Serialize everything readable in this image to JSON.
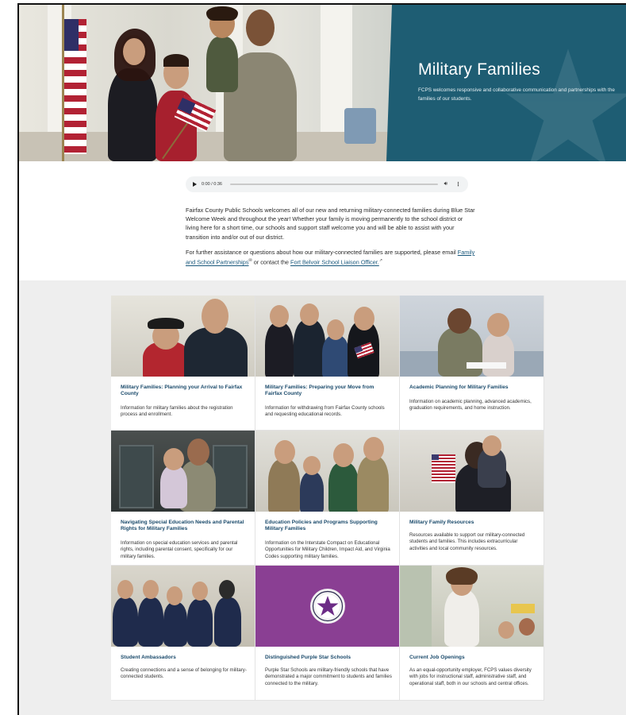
{
  "hero": {
    "title": "Military Families",
    "subtitle": "FCPS welcomes responsive and collaborative communication and partnerships with the families of our students."
  },
  "audio": {
    "time": "0:00 / 0:36",
    "progress": 0.0
  },
  "intro": {
    "paragraph1": "Fairfax County Public Schools welcomes all of our new and returning military-connected families during Blue Star Welcome Week and throughout the year!  Whether your family is moving permanently to the school district or living here for a short time, our schools and support staff welcome you and will be able to assist with your transition into and/or out of our district.",
    "paragraph2_prefix": "For further assistance or questions about how our military-connected families are supported, please email",
    "link1": "Family and School Partnerships",
    "paragraph2_mid": "or contact the",
    "link2": "Fort Belvoir School Liaison Officer."
  },
  "cards": [
    {
      "title": "Military Families: Planning your Arrival to Fairfax County",
      "description": "Information for military families about the registration process and enrollment.",
      "icon": "photo"
    },
    {
      "title": "Military Families: Preparing your Move from Fairfax County",
      "description": "Information for withdrawing from Fairfax County schools and requesting educational records.",
      "icon": "photo"
    },
    {
      "title": "Academic Planning for Military Families",
      "description": "Information on academic planning, advanced academics, graduation requirements, and home instruction.",
      "icon": "photo"
    },
    {
      "title": "Navigating Special Education Needs and Parental Rights for Military Families",
      "description": "Information on special education services and parental rights, including parental consent, specifically for our military families.",
      "icon": "photo"
    },
    {
      "title": "Education Policies and Programs Supporting Military Families",
      "description": "Information on the Interstate Compact on Educational Opportunities for Military Children, Impact Aid, and Virginia Codes supporting military families.",
      "icon": "photo"
    },
    {
      "title": "Military Family Resources",
      "description": "Resources available to support our military-connected students and families. This includes extracurricular activities and local community resources.",
      "icon": "photo"
    },
    {
      "title": "Student Ambassadors",
      "description": "Creating connections and a sense of belonging for military-connected students.",
      "icon": "photo"
    },
    {
      "title": "Distinguished Purple Star Schools",
      "description": "Purple Star Schools are military-friendly schools that have demonstrated a major commitment to students and families connected to the military.",
      "icon": "purple-star-badge"
    },
    {
      "title": "Current Job Openings",
      "description": "As an equal-opportunity employer, FCPS values diversity with jobs for instructional staff, administrative staff, and operational staff, both in our schools and central offices.",
      "icon": "photo"
    }
  ],
  "colors": {
    "hero_panel": "#1e5d73",
    "link": "#16567a",
    "card_title": "#1a4a6b",
    "purple_tile": "#8a3f93",
    "grid_background": "#eeeeee"
  }
}
